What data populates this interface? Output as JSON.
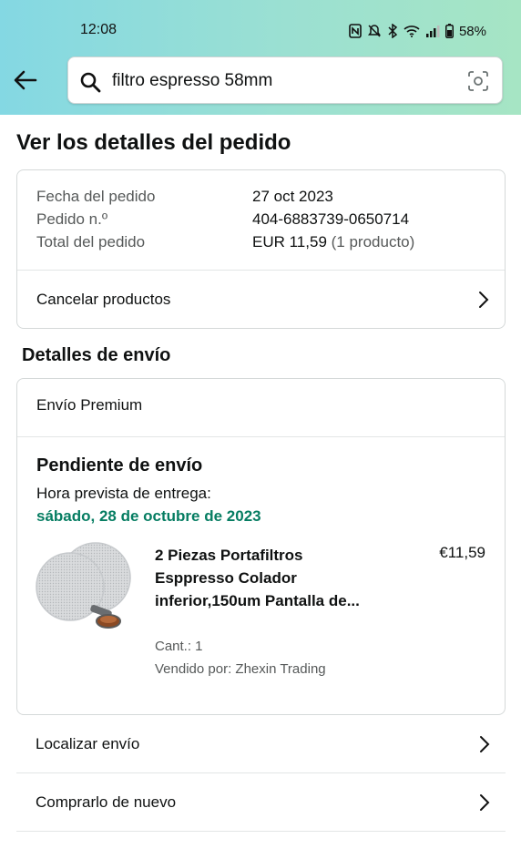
{
  "status_bar": {
    "time": "12:08",
    "battery": "58%",
    "icons": [
      "nfc-icon",
      "mute-icon",
      "bluetooth-icon",
      "wifi-icon",
      "signal-icon",
      "battery-icon"
    ]
  },
  "search": {
    "query": "filtro espresso 58mm"
  },
  "page": {
    "title": "Ver los detalles del pedido"
  },
  "order_summary": {
    "rows": [
      {
        "label": "Fecha del pedido",
        "value": "27 oct 2023"
      },
      {
        "label": "Pedido n.º",
        "value": "404-6883739-0650714"
      },
      {
        "label": "Total del pedido",
        "value": "EUR 11,59",
        "extra": "(1 producto)"
      }
    ],
    "cancel_label": "Cancelar productos"
  },
  "shipping": {
    "section_title": "Detalles de envío",
    "type": "Envío Premium",
    "status": "Pendiente de envío",
    "eta_label": "Hora prevista de entrega:",
    "eta_date": "sábado, 28 de octubre de 2023",
    "product": {
      "title": "2 Piezas Portafiltros Esppresso Colador inferior,150um Pantalla de...",
      "price": "€11,59",
      "quantity": "Cant.: 1",
      "seller": "Vendido por: Zhexin Trading"
    }
  },
  "actions": {
    "track": "Localizar envío",
    "buy_again": "Comprarlo de nuevo"
  },
  "colors": {
    "header_gradient_start": "#84d8e3",
    "header_gradient_end": "#a6e5c4",
    "delivery_green": "#067d62"
  }
}
